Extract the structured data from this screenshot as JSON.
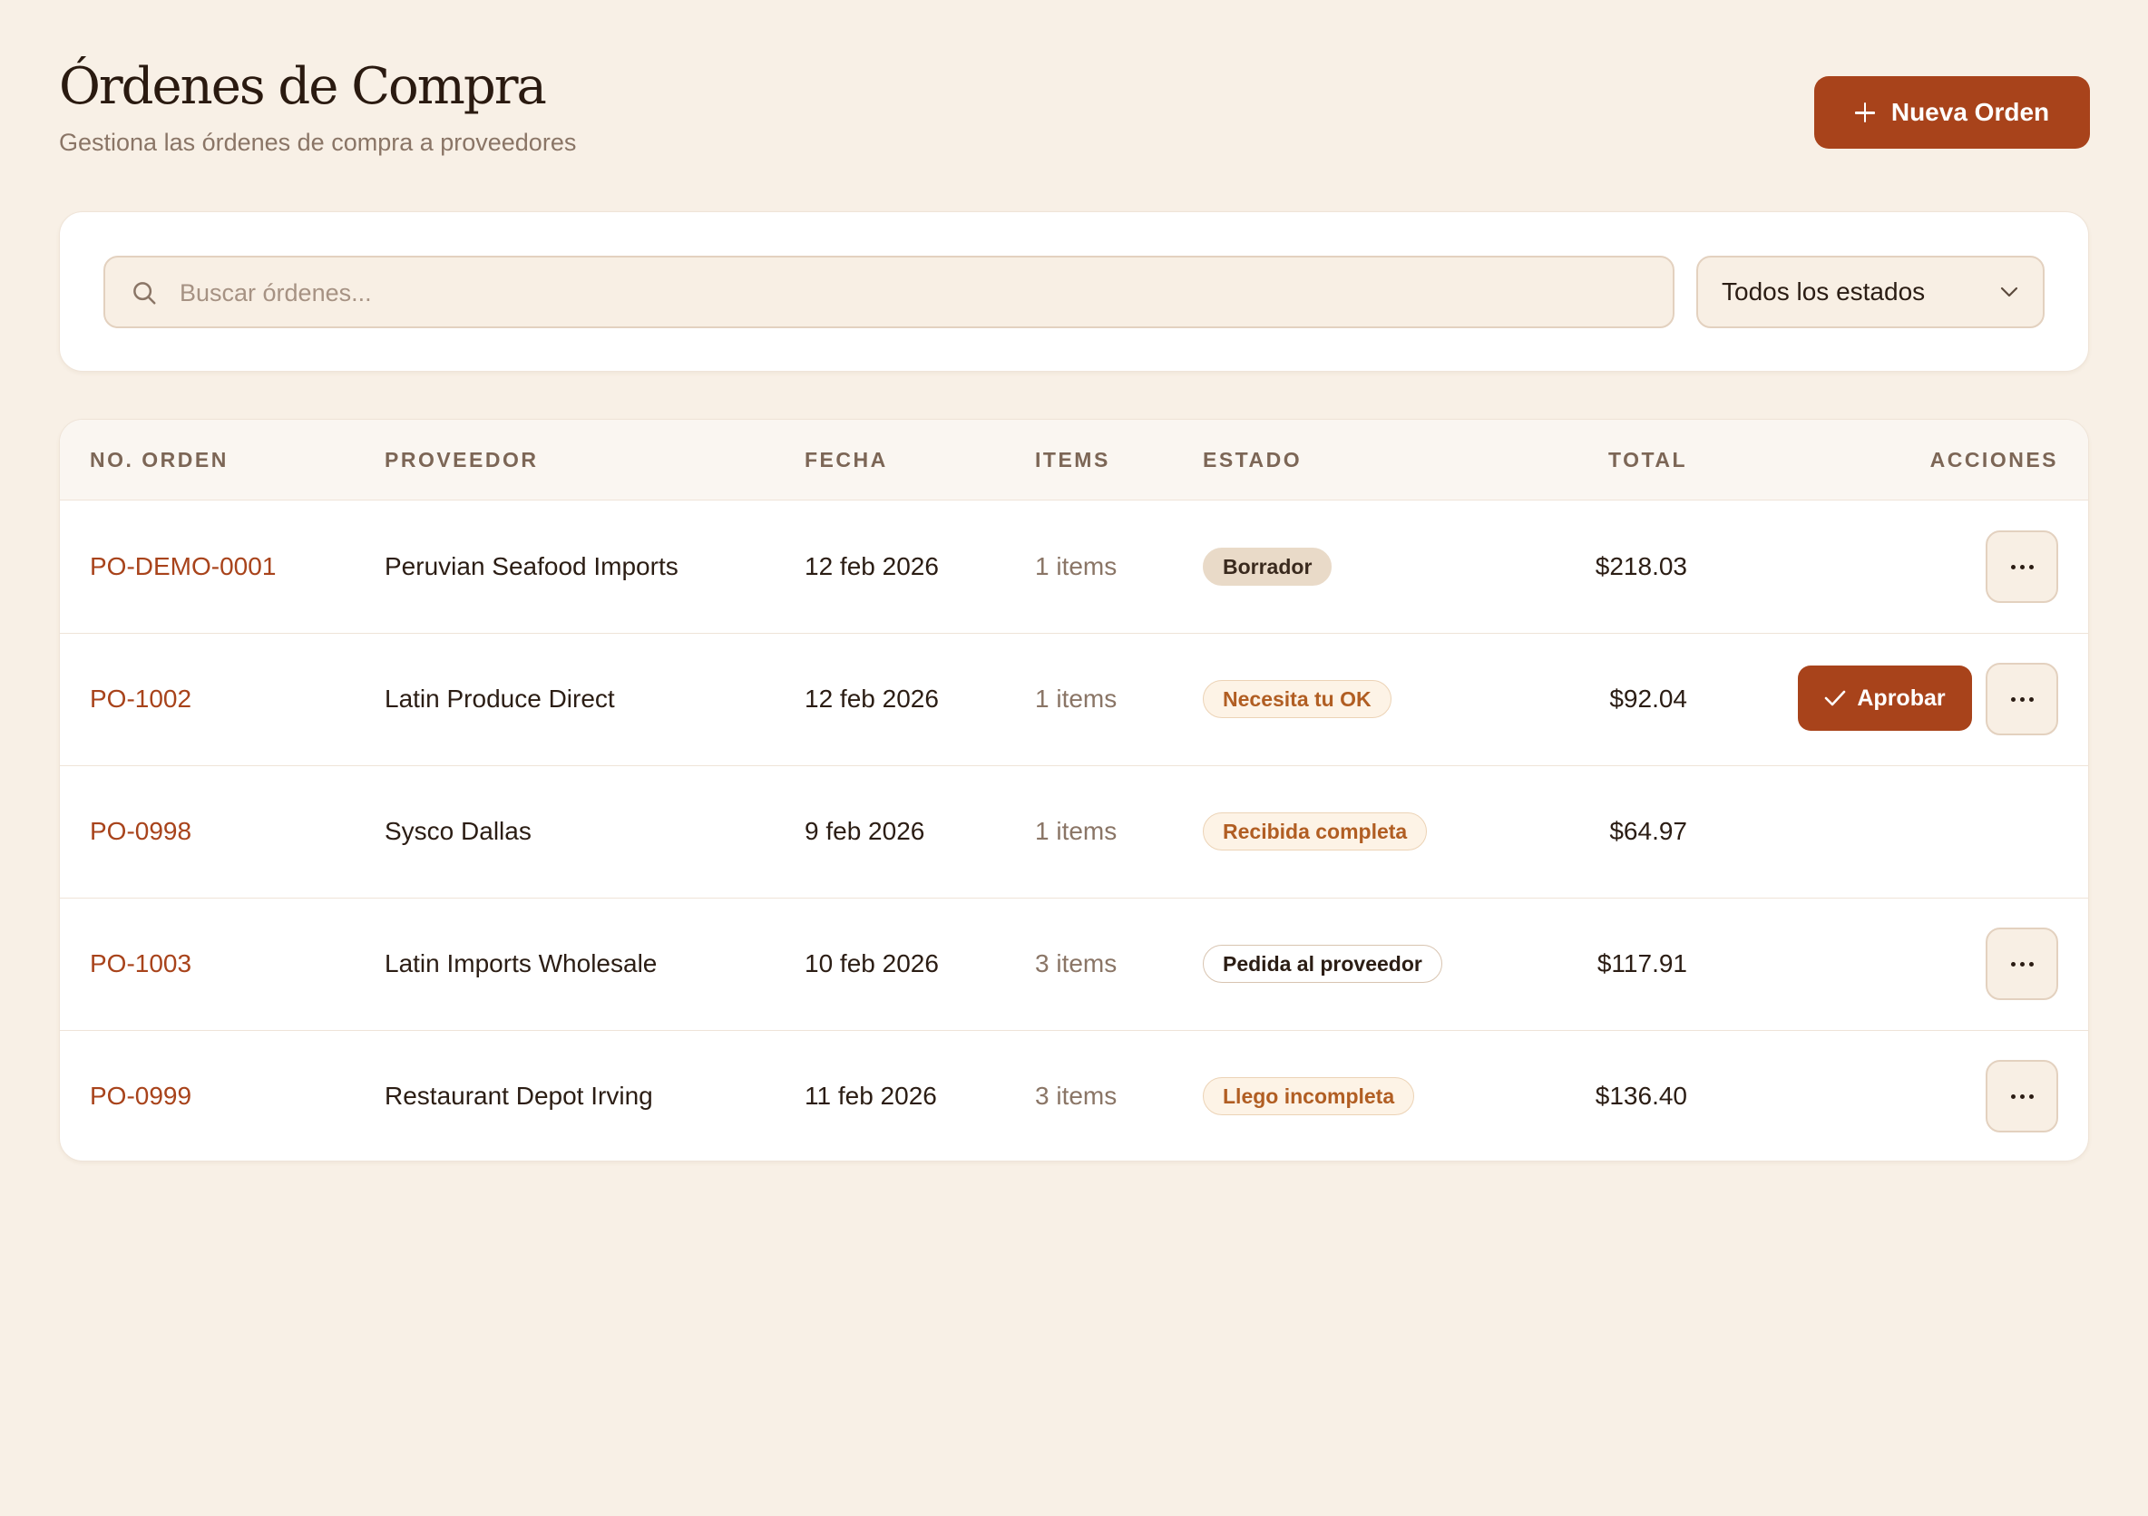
{
  "header": {
    "title": "Órdenes de Compra",
    "subtitle": "Gestiona las órdenes de compra a proveedores",
    "new_button_label": "Nueva Orden"
  },
  "filters": {
    "search_placeholder": "Buscar órdenes...",
    "search_value": "",
    "status_selected": "Todos los estados"
  },
  "table": {
    "columns": {
      "order": "NO. ORDEN",
      "supplier": "PROVEEDOR",
      "date": "FECHA",
      "items": "ITEMS",
      "status": "ESTADO",
      "total": "TOTAL",
      "actions": "ACCIONES"
    },
    "approve_label": "Aprobar",
    "rows": [
      {
        "order": "PO-DEMO-0001",
        "supplier": "Peruvian Seafood Imports",
        "date": "12 feb 2026",
        "items": "1 items",
        "status": "Borrador",
        "total": "$218.03"
      },
      {
        "order": "PO-1002",
        "supplier": "Latin Produce Direct",
        "date": "12 feb 2026",
        "items": "1 items",
        "status": "Necesita tu OK",
        "total": "$92.04"
      },
      {
        "order": "PO-0998",
        "supplier": "Sysco Dallas",
        "date": "9 feb 2026",
        "items": "1 items",
        "status": "Recibida completa",
        "total": "$64.97"
      },
      {
        "order": "PO-1003",
        "supplier": "Latin Imports Wholesale",
        "date": "10 feb 2026",
        "items": "3 items",
        "status": "Pedida al proveedor",
        "total": "$117.91"
      },
      {
        "order": "PO-0999",
        "supplier": "Restaurant Depot Irving",
        "date": "11 feb 2026",
        "items": "3 items",
        "status": "Llego incompleta",
        "total": "$136.40"
      }
    ]
  },
  "colors": {
    "accent": "#a8431b",
    "background": "#f8f0e6",
    "card": "#ffffff",
    "status_warm_text": "#b15e23",
    "status_draft_bg": "#e9dac8"
  },
  "icons": {
    "new_button": "plus-icon",
    "search": "search-icon",
    "select": "chevron-down-icon",
    "approve": "check-icon",
    "more": "more-horizontal-icon"
  }
}
